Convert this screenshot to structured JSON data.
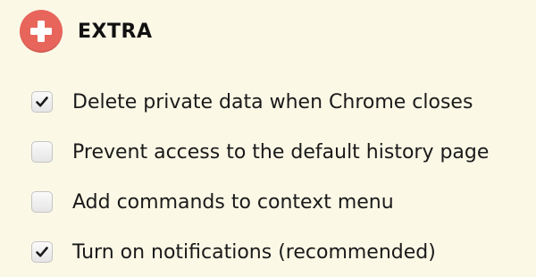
{
  "section": {
    "icon": "plus-icon",
    "title": "EXTRA",
    "accent_color": "#e8655b"
  },
  "options": [
    {
      "label": "Delete private data when Chrome closes",
      "checked": true
    },
    {
      "label": "Prevent access to the default history page",
      "checked": false
    },
    {
      "label": "Add commands to context menu",
      "checked": false
    },
    {
      "label": "Turn on notifications (recommended)",
      "checked": true
    }
  ]
}
